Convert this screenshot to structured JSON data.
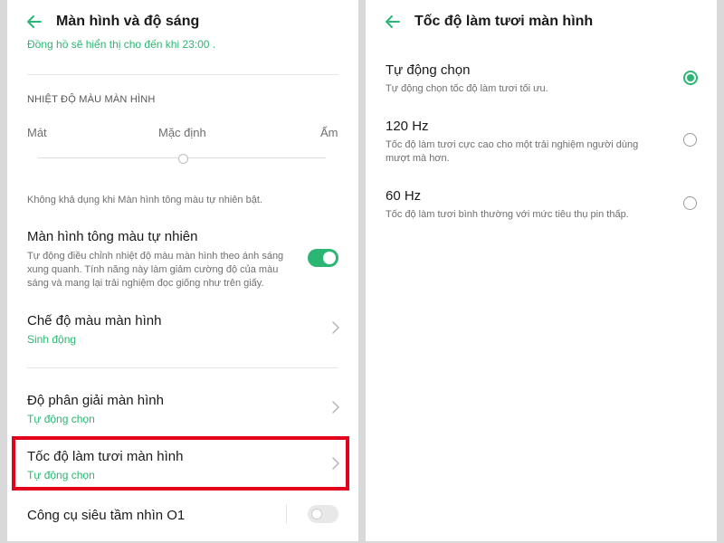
{
  "left": {
    "header": {
      "title": "Màn hình và độ sáng"
    },
    "top_note": "Đồng hồ sẽ hiển thị cho đến khi  23:00 .",
    "color_temp": {
      "section_label": "NHIỆT ĐỘ MÀU MÀN HÌNH",
      "label_cool": "Mát",
      "label_default": "Mặc định",
      "label_warm": "Ấm",
      "value": 0.5,
      "unavailable_note": "Không khả dụng khi Màn hình tông màu tự nhiên bật."
    },
    "natural_tone": {
      "title": "Màn hình tông màu tự nhiên",
      "desc_line1": "Tự động điều chỉnh nhiệt độ màu màn hình theo ánh sáng",
      "desc_line2": "xung quanh. Tính năng này làm giảm cường độ của màu",
      "desc_line3": "sáng và mang lại trải nghiệm đọc giống như trên giấy.",
      "enabled": true
    },
    "color_mode": {
      "title": "Chế độ màu màn hình",
      "value": "Sinh động"
    },
    "resolution": {
      "title": "Độ phân giải màn hình",
      "value": "Tự động chọn"
    },
    "refresh_rate": {
      "title": "Tốc độ làm tươi màn hình",
      "value": "Tự động chọn"
    },
    "o1_tool": {
      "title": "Công cụ siêu tầm nhìn O1",
      "enabled": false
    }
  },
  "right": {
    "header": {
      "title": "Tốc độ làm tươi màn hình"
    },
    "options": [
      {
        "title": "Tự động chọn",
        "desc_line1": "Tự động chọn tốc độ làm tươi tối ưu.",
        "desc_line2": "",
        "selected": true
      },
      {
        "title": "120 Hz",
        "desc_line1": "Tốc độ làm tươi cực cao cho một trải nghiệm người dùng",
        "desc_line2": "mượt mà hơn.",
        "selected": false
      },
      {
        "title": "60 Hz",
        "desc_line1": "Tốc độ làm tươi bình thường với mức tiêu thụ pin thấp.",
        "desc_line2": "",
        "selected": false
      }
    ]
  },
  "colors": {
    "accent": "#2bb673",
    "highlight": "#e3001b"
  },
  "icons": {
    "back": "arrow-left-icon",
    "chevron": "chevron-right-icon"
  }
}
